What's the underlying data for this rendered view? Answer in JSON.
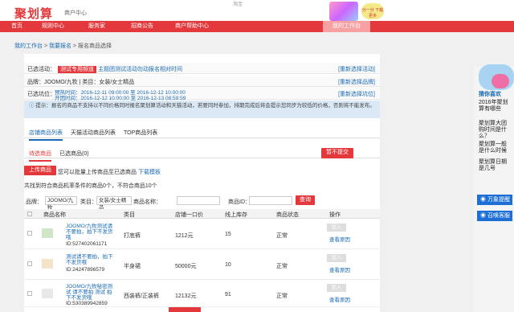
{
  "header": {
    "logo": "聚划算",
    "subtitle": "商户中心",
    "top_center": "淘宝",
    "promo_badge": "分一分 下载更多"
  },
  "nav": {
    "items": [
      "首页",
      "规则中心",
      "服务家",
      "招商公告",
      "商户帮助中心"
    ],
    "mine": "我的工作台"
  },
  "breadcrumb": {
    "home": "我的工作台",
    "sep1": " > ",
    "mid": "我要报名",
    "sep2": " > ",
    "current": "报名商品选择"
  },
  "info": {
    "activity_label": "已选活动：",
    "activity_tag": "测试专用频道",
    "activity_name": "主题团测试活动勿动报名相对时间",
    "activity_link": "[重新选择活动]",
    "brand_line": "品牌：JOOMO/九牧 | 类目：女装/女士精品",
    "brand_link": "[重新选择品牌]",
    "slot_label": "已选坑位：",
    "slot_line1": "预热时间：2016-12-11 09:00:00 至 2016-12-12 10:00:00",
    "slot_line2": "开团时间：2016-12-12 10:00:00 至 2016-12-13 08:59:59",
    "slot_link": "[重新选择坑位]"
  },
  "hint": "提示：报名的商品不支持以不同价格同时报名聚划算活动和天猫活动，若要同时参加，排期完成后将会提示您同步为较低的价格，否则将不能发布。",
  "tabs": [
    "店铺商品列表",
    "天猫活动商品列表",
    "TOP商品列表"
  ],
  "subtabs": {
    "pending": "待选商品",
    "selected": "已选商品(0)"
  },
  "submit_label": "暂不提交",
  "upload": {
    "button": "上传商品",
    "desc": "您可以批量上传商品至已选商品",
    "link": "下载模板"
  },
  "count_text": "共找到符合商品机率条件的商品0个，不符合商品10个",
  "filter": {
    "brand_label": "品牌：",
    "brand_value": "JOOMO/九牧",
    "cat_label": "类目：",
    "cat_value": "女装/女士精品",
    "name_label": "商品名称：",
    "name_value": "",
    "id_label": "商品ID：",
    "id_value": "",
    "search": "查询"
  },
  "table": {
    "headers": [
      "商品名称",
      "类目",
      "店铺一口价",
      "线上库存",
      "商品状态",
      "操作"
    ],
    "rows": [
      {
        "name": "JOOMO/九牧测试请不要拍，拍下不发货哦",
        "id": "ID:527402061171",
        "cat": "打底裤",
        "price": "1212元",
        "stock": "15",
        "status": "正常",
        "add": "加入",
        "why": "查看原因"
      },
      {
        "name": "测试请不要拍，拍下不发货哦",
        "id": "ID:24247896579",
        "cat": "半身裙",
        "price": "50000元",
        "stock": "10",
        "status": "正常",
        "add": "加入",
        "why": "查看原因"
      },
      {
        "name": "JOOMO/九牧秘密测试 请不要拍 测试 拍下不发货哦",
        "id": "ID:530389942859",
        "cat": "西装裤/正装裤",
        "price": "12132元",
        "stock": "91",
        "status": "正常",
        "add": "加入",
        "why": "查看原因"
      }
    ]
  },
  "right": {
    "cloud": "猜你喜欢",
    "links": [
      "2016年聚划算有哪些",
      "聚划算大团购时间是什么？",
      "聚划算一般是什么时候",
      "聚划算日期是几号"
    ],
    "btn1": "万象提醒",
    "btn2": "召唤客服"
  }
}
